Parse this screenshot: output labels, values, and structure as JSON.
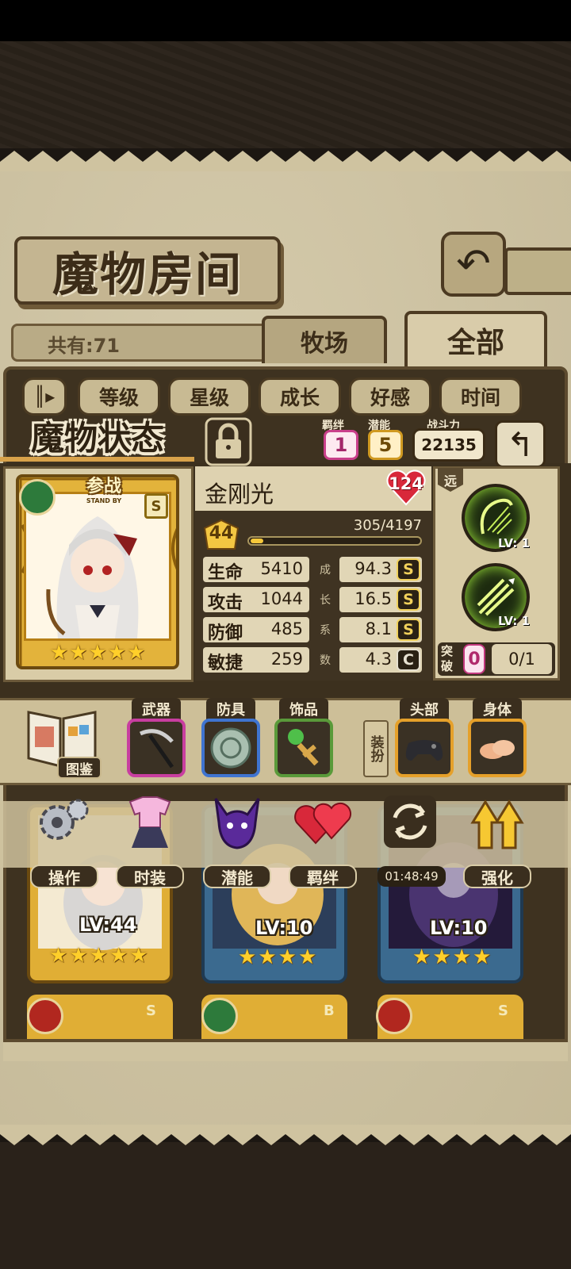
{
  "header": {
    "title": "魔物房间",
    "count_label": "共有:71",
    "filter_tabs": [
      "牧场",
      "全部"
    ]
  },
  "sort_buttons": [
    "等级",
    "星级",
    "成长",
    "好感",
    "时间"
  ],
  "status_window": {
    "title": "魔物状态",
    "bond_label": "羁绊",
    "bond_value": "1",
    "potential_label": "潜能",
    "potential_value": "5",
    "power_label": "战斗力",
    "power_value": "22135",
    "card": {
      "standby_cn": "参战",
      "standby_en": "STAND BY",
      "rank": "S",
      "element": "leaf-icon",
      "stars": 5
    },
    "monster_name": "金刚光",
    "affection": "124",
    "level": "44",
    "exp_text": "305/4197",
    "exp_fraction": 0.073,
    "stats": [
      {
        "name": "生命",
        "value": "5410",
        "growth": "94.3",
        "rank": "S"
      },
      {
        "name": "攻击",
        "value": "1044",
        "growth": "16.5",
        "rank": "S"
      },
      {
        "name": "防御",
        "value": "485",
        "growth": "8.1",
        "rank": "S"
      },
      {
        "name": "敏捷",
        "value": "259",
        "growth": "4.3",
        "rank": "C"
      }
    ],
    "growth_vertical_label": [
      "成",
      "长",
      "系",
      "数"
    ],
    "range_tag": "远",
    "skills": [
      {
        "icon": "harp-skill-icon",
        "level": "LV: 1"
      },
      {
        "icon": "arrow-volley-skill-icon",
        "level": "LV: 1"
      }
    ],
    "breakthrough_label": "突破",
    "breakthrough_value": "0",
    "breakthrough_progress": "0/1"
  },
  "equipment": {
    "book_label": "图鉴",
    "slots": [
      {
        "label": "武器",
        "icon": "scythe-icon"
      },
      {
        "label": "防具",
        "icon": "shield-icon"
      },
      {
        "label": "饰品",
        "icon": "kendama-icon"
      }
    ],
    "dress_label": "装扮",
    "dress_slots": [
      {
        "label": "头部",
        "icon": "gamepad-icon"
      },
      {
        "label": "身体",
        "icon": "bread-icon"
      }
    ]
  },
  "actions": [
    {
      "label": "操作",
      "icon": "gear-icon"
    },
    {
      "label": "时装",
      "icon": "outfit-icon"
    },
    {
      "label": "潜能",
      "icon": "demon-icon"
    },
    {
      "label": "羁绊",
      "icon": "hearts-icon"
    },
    {
      "label": "01:48:49",
      "icon": "swap-icon"
    },
    {
      "label": "强化",
      "icon": "upgrade-arrows-icon"
    }
  ],
  "monster_list": [
    {
      "level": "LV:44",
      "stars": 5
    },
    {
      "level": "LV:10",
      "stars": 4
    },
    {
      "level": "LV:10",
      "stars": 4
    }
  ],
  "monster_list_row2_ranks": [
    "S",
    "B",
    "S"
  ],
  "colors": {
    "parchment": "#cfc3a0",
    "dark_panel": "#3e3220",
    "gold": "#e3b33b",
    "bond_pink": "#c93f8a",
    "skill_glow": "#9be03a"
  }
}
